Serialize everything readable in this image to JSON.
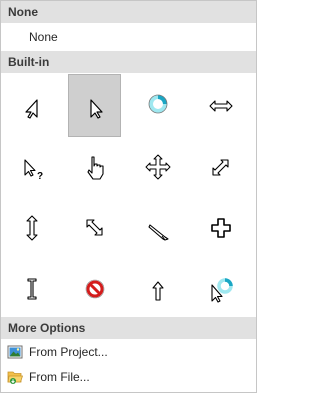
{
  "sections": {
    "none_header": "None",
    "none_item": "None",
    "builtin_header": "Built-in",
    "more_header": "More Options"
  },
  "cursors": [
    {
      "name": "arrow-left-cursor-icon",
      "selected": false
    },
    {
      "name": "arrow-cursor-icon",
      "selected": true
    },
    {
      "name": "busy-ring-cursor-icon",
      "selected": false
    },
    {
      "name": "resize-horizontal-cursor-icon",
      "selected": false
    },
    {
      "name": "help-select-cursor-icon",
      "selected": false
    },
    {
      "name": "hand-cursor-icon",
      "selected": false
    },
    {
      "name": "move-cursor-icon",
      "selected": false
    },
    {
      "name": "resize-diagonal-ne-cursor-icon",
      "selected": false
    },
    {
      "name": "resize-vertical-cursor-icon",
      "selected": false
    },
    {
      "name": "resize-diagonal-nw-cursor-icon",
      "selected": false
    },
    {
      "name": "pen-cursor-icon",
      "selected": false
    },
    {
      "name": "cross-cursor-icon",
      "selected": false
    },
    {
      "name": "text-beam-cursor-icon",
      "selected": false
    },
    {
      "name": "unavailable-cursor-icon",
      "selected": false
    },
    {
      "name": "up-arrow-cursor-icon",
      "selected": false
    },
    {
      "name": "working-in-background-cursor-icon",
      "selected": false
    }
  ],
  "options": {
    "from_project": "From Project...",
    "from_file": "From File..."
  }
}
